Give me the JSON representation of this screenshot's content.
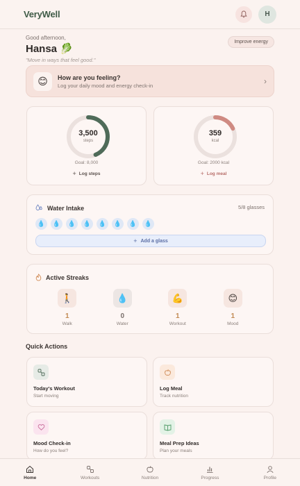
{
  "header": {
    "brand": "VeryWell",
    "avatar_initial": "H"
  },
  "greeting": {
    "salutation": "Good afternoon,",
    "name": "Hansa",
    "name_emoji": "🥬",
    "quote": "\"Move in ways that feel good.\"",
    "improve_label": "Improve energy"
  },
  "feeling": {
    "emoji": "😊",
    "title": "How are you feeling?",
    "subtitle": "Log your daily mood and energy check-in"
  },
  "steps": {
    "value": "3,500",
    "unit": "steps",
    "goal": "Goal: 8,000",
    "action": "Log steps",
    "progress": 0.4375
  },
  "calories": {
    "value": "359",
    "unit": "kcal",
    "goal": "Goal: 2000 kcal",
    "action": "Log meal",
    "progress": 0.18
  },
  "water": {
    "title": "Water Intake",
    "count": "5/8 glasses",
    "glasses": 8,
    "add_label": "Add a glass"
  },
  "streaks": {
    "title": "Active Streaks",
    "items": [
      {
        "icon": "🚶",
        "value": "1",
        "label": "Walk"
      },
      {
        "icon": "💧",
        "value": "0",
        "label": "Water"
      },
      {
        "icon": "💪",
        "value": "1",
        "label": "Workout"
      },
      {
        "icon": "😊",
        "value": "1",
        "label": "Mood"
      }
    ]
  },
  "quick_actions": {
    "title": "Quick Actions",
    "items": [
      {
        "label": "Today's Workout",
        "sub": "Start moving"
      },
      {
        "label": "Log Meal",
        "sub": "Track nutrition"
      },
      {
        "label": "Mood Check-in",
        "sub": "How do you feel?"
      },
      {
        "label": "Meal Prep Ideas",
        "sub": "Plan your meals"
      }
    ]
  },
  "nav": {
    "items": [
      "Home",
      "Workouts",
      "Nutrition",
      "Progress",
      "Profile"
    ]
  },
  "colors": {
    "brand_green": "#3f5b47",
    "steps_ring": "#4f6b59",
    "calorie_ring": "#cf8a82",
    "ring_track": "#ebe1de",
    "water_blue": "#5c6fa6"
  }
}
